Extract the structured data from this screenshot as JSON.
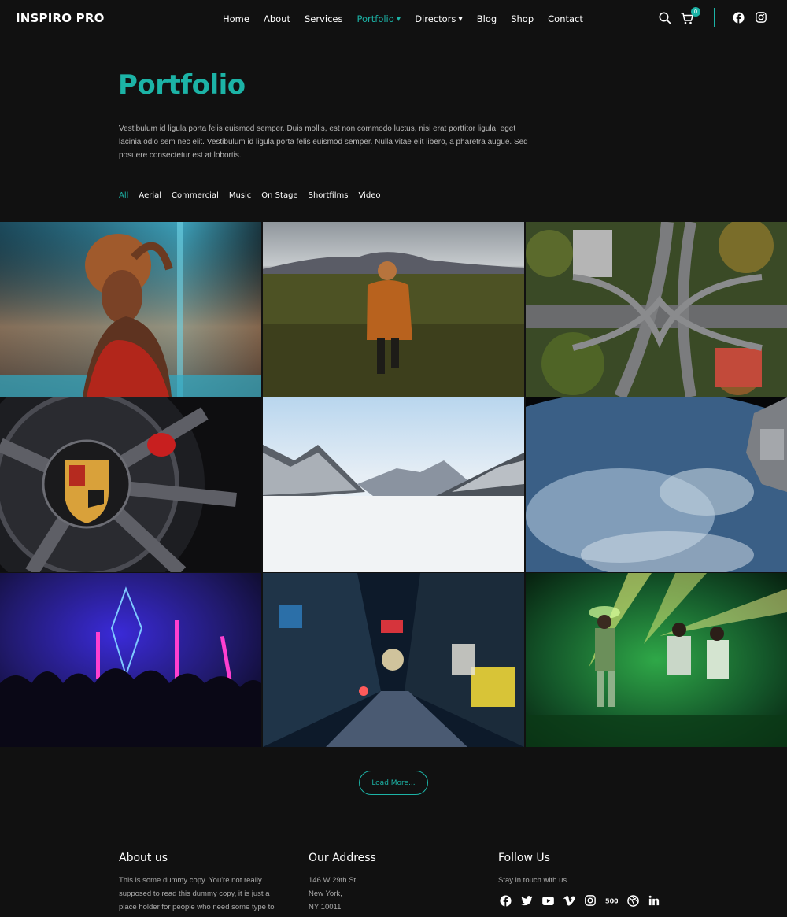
{
  "brand": {
    "logo": "INSPIRO PRO",
    "accent": "#1cb3a6"
  },
  "nav": {
    "items": [
      {
        "label": "Home",
        "active": false,
        "dropdown": false
      },
      {
        "label": "About",
        "active": false,
        "dropdown": false
      },
      {
        "label": "Services",
        "active": false,
        "dropdown": false
      },
      {
        "label": "Portfolio",
        "active": true,
        "dropdown": true
      },
      {
        "label": "Directors",
        "active": false,
        "dropdown": true
      },
      {
        "label": "Blog",
        "active": false,
        "dropdown": false
      },
      {
        "label": "Shop",
        "active": false,
        "dropdown": false
      },
      {
        "label": "Contact",
        "active": false,
        "dropdown": false
      }
    ],
    "cart_count": "0",
    "icons": [
      "search-icon",
      "cart-icon",
      "facebook-icon",
      "instagram-icon"
    ]
  },
  "hero": {
    "title": "Portfolio",
    "intro": "Vestibulum id ligula porta felis euismod semper. Duis mollis, est non commodo luctus, nisi erat porttitor ligula, eget lacinia odio sem nec elit. Vestibulum id ligula porta felis euismod semper. Nulla vitae elit libero, a pharetra augue. Sed posuere consectetur est at lobortis."
  },
  "filters": [
    {
      "label": "All",
      "active": true
    },
    {
      "label": "Aerial",
      "active": false
    },
    {
      "label": "Commercial",
      "active": false
    },
    {
      "label": "Music",
      "active": false
    },
    {
      "label": "On Stage",
      "active": false
    },
    {
      "label": "Shortfilms",
      "active": false
    },
    {
      "label": "Video",
      "active": false
    }
  ],
  "portfolio": {
    "items": [
      {
        "subject": "woman-portrait"
      },
      {
        "subject": "woman-in-field"
      },
      {
        "subject": "highway-interchange-aerial"
      },
      {
        "subject": "porsche-wheel"
      },
      {
        "subject": "snowy-mountains"
      },
      {
        "subject": "earth-from-space"
      },
      {
        "subject": "concert-crowd-neon"
      },
      {
        "subject": "night-alley"
      },
      {
        "subject": "stage-performers-green"
      }
    ],
    "load_more_label": "Load More..."
  },
  "footer": {
    "about": {
      "heading": "About us",
      "lines": [
        "This is some dummy copy. You're not really",
        "supposed to read this dummy copy, it is just a",
        "place holder for people who need some type to"
      ]
    },
    "address": {
      "heading": "Our Address",
      "lines": [
        "146 W 29th St,",
        "New York,",
        "NY 10011"
      ]
    },
    "follow": {
      "heading": "Follow Us",
      "subtitle": "Stay in touch with us",
      "icons": [
        "facebook-icon",
        "twitter-icon",
        "youtube-icon",
        "vimeo-icon",
        "instagram-icon",
        "500px-icon",
        "dribbble-icon",
        "linkedin-icon"
      ]
    }
  }
}
